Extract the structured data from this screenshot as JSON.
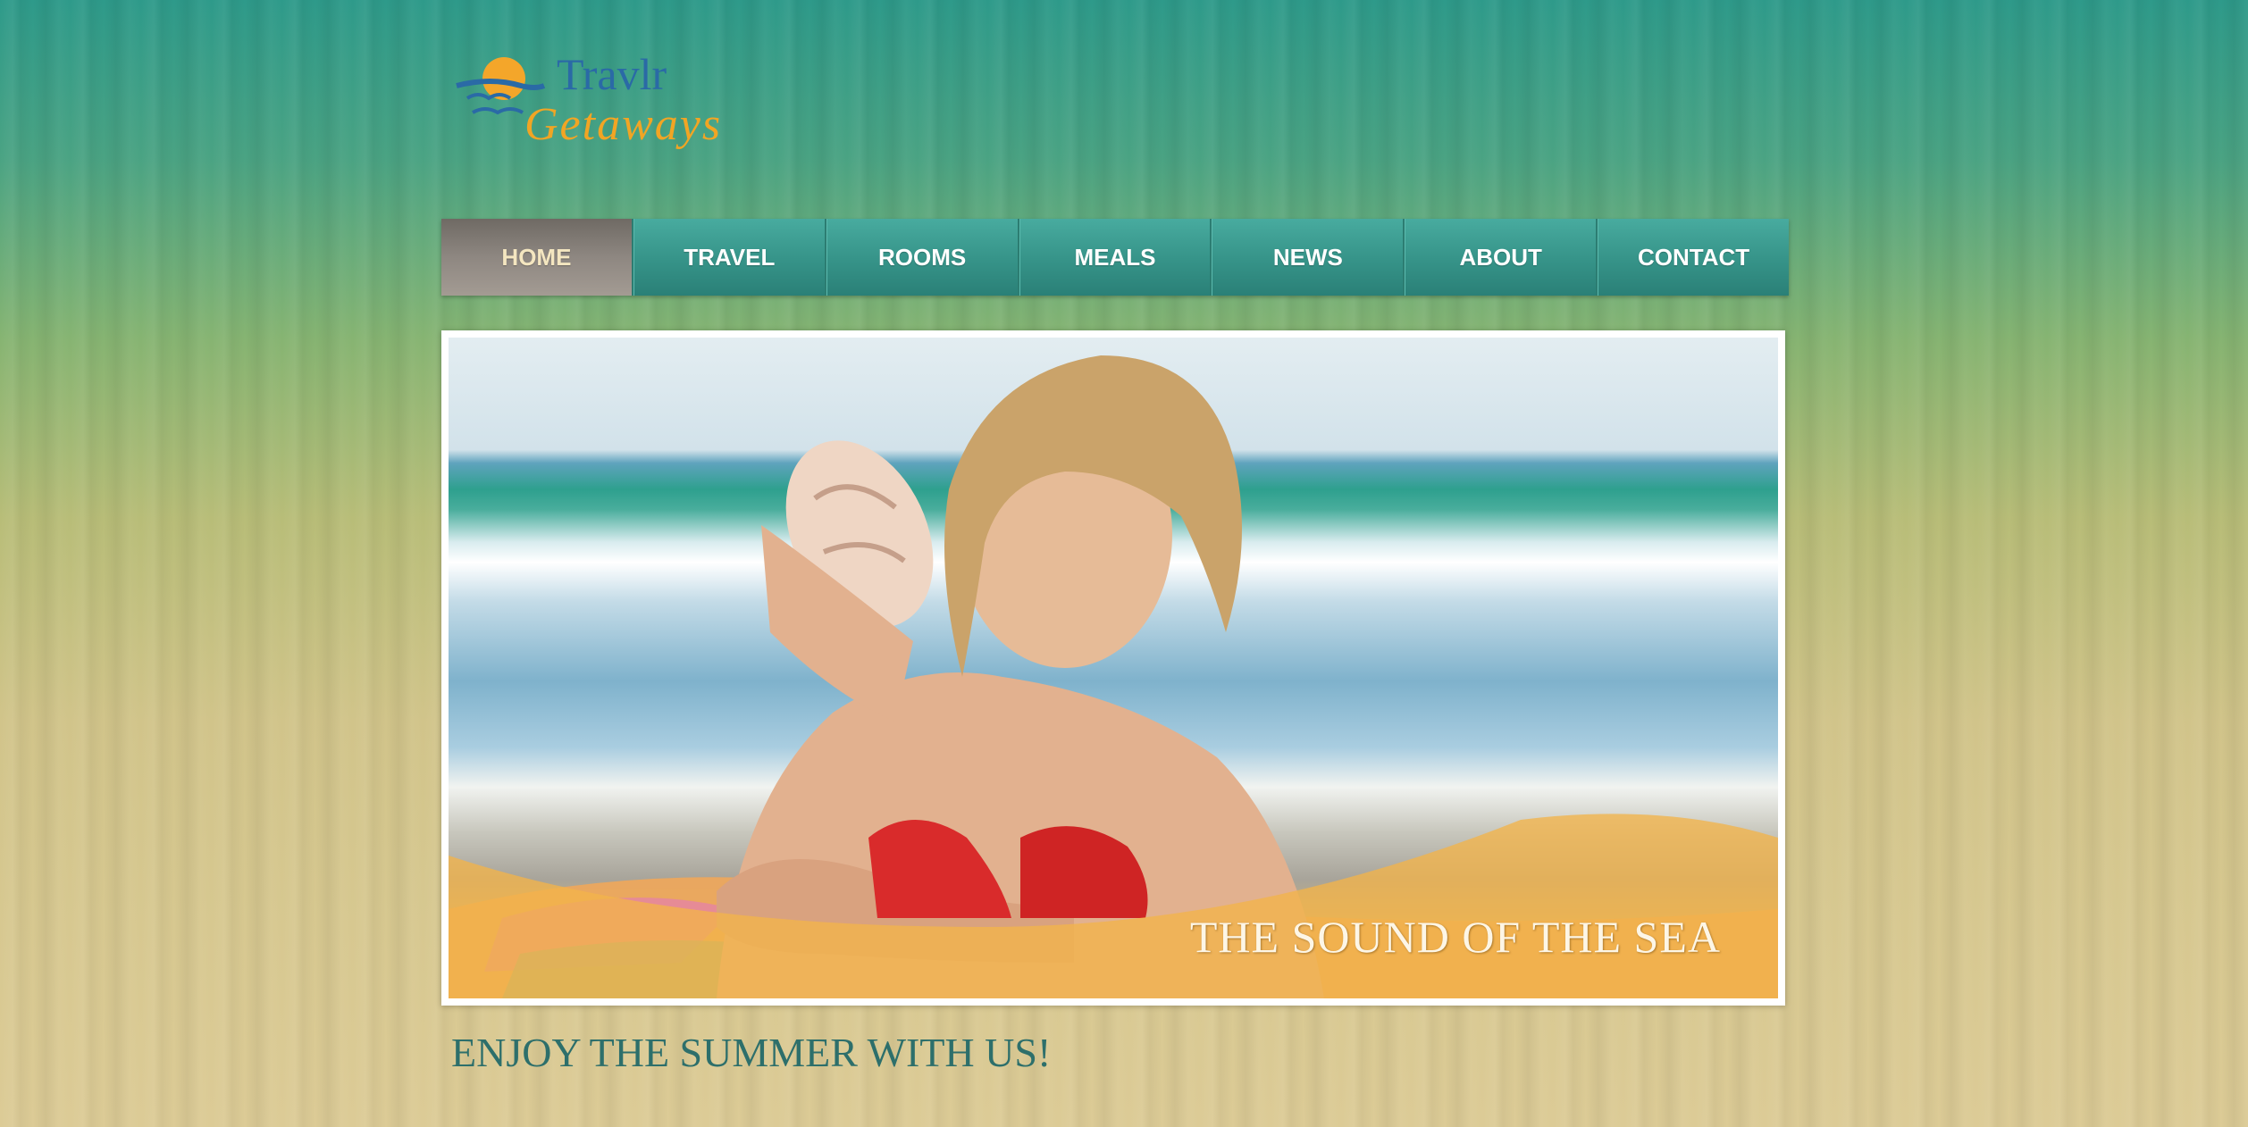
{
  "brand": {
    "name_line1": "Travlr",
    "name_line2": "Getaways",
    "icon": "sun-over-waves-logo",
    "colors": {
      "blue": "#2a6aa6",
      "orange": "#f1a524"
    }
  },
  "nav": {
    "items": [
      {
        "label": "HOME",
        "active": true
      },
      {
        "label": "TRAVEL",
        "active": false
      },
      {
        "label": "ROOMS",
        "active": false
      },
      {
        "label": "MEALS",
        "active": false
      },
      {
        "label": "NEWS",
        "active": false
      },
      {
        "label": "ABOUT",
        "active": false
      },
      {
        "label": "CONTACT",
        "active": false
      }
    ],
    "colors": {
      "item": "#37958a",
      "active": "#8e8781",
      "active_text": "#f4e6c0"
    }
  },
  "hero": {
    "caption": "THE SOUND OF THE SEA",
    "image": "woman-on-beach-holding-seashell-photo"
  },
  "main": {
    "tagline": "ENJOY THE SUMMER WITH US!"
  }
}
